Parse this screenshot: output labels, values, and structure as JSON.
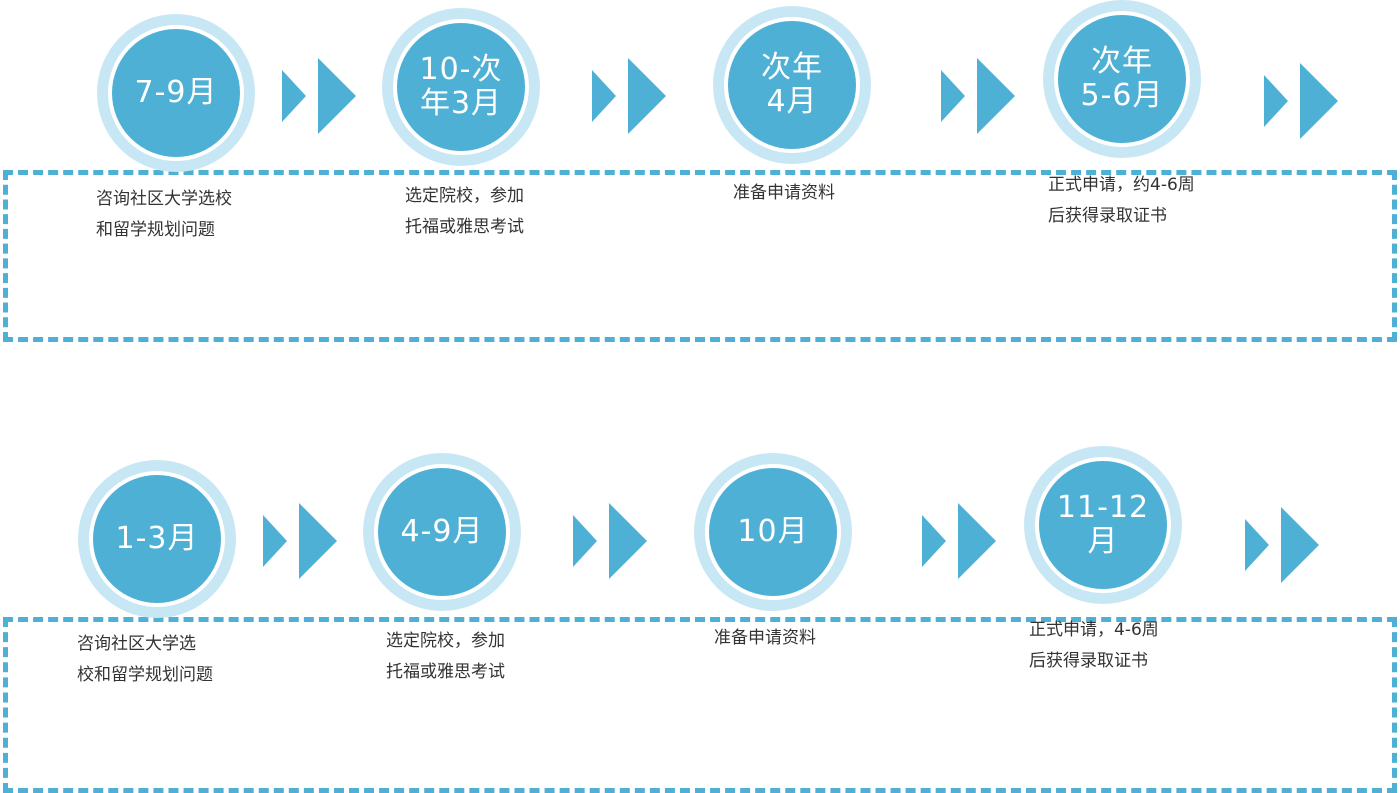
{
  "rows": [
    {
      "steps": [
        {
          "label_lines": [
            "7-9月"
          ],
          "desc_lines": [
            "咨询社区大学选校",
            "和留学规划问题"
          ]
        },
        {
          "label_lines": [
            "10-次",
            "年3月"
          ],
          "desc_lines": [
            "选定院校，参加",
            "托福或雅思考试"
          ]
        },
        {
          "label_lines": [
            "次年",
            "4月"
          ],
          "desc_lines": [
            "准备申请资料"
          ]
        },
        {
          "label_lines": [
            "次年",
            "5-6月"
          ],
          "desc_lines": [
            "正式申请，约4-6周",
            "后获得录取证书"
          ]
        }
      ]
    },
    {
      "steps": [
        {
          "label_lines": [
            "1-3月"
          ],
          "desc_lines": [
            "咨询社区大学选",
            "校和留学规划问题"
          ]
        },
        {
          "label_lines": [
            "4-9月"
          ],
          "desc_lines": [
            "选定院校，参加",
            "托福或雅思考试"
          ]
        },
        {
          "label_lines": [
            "10月"
          ],
          "desc_lines": [
            "准备申请资料"
          ]
        },
        {
          "label_lines": [
            "11-12",
            "月"
          ],
          "desc_lines": [
            "正式申请，4-6周",
            "后获得录取证书"
          ]
        }
      ]
    }
  ],
  "colors": {
    "primary": "#4fb0d6",
    "light": "#c8e7f5",
    "text": "#333333"
  },
  "icons": {
    "arrow": "double-chevron-right-icon"
  }
}
